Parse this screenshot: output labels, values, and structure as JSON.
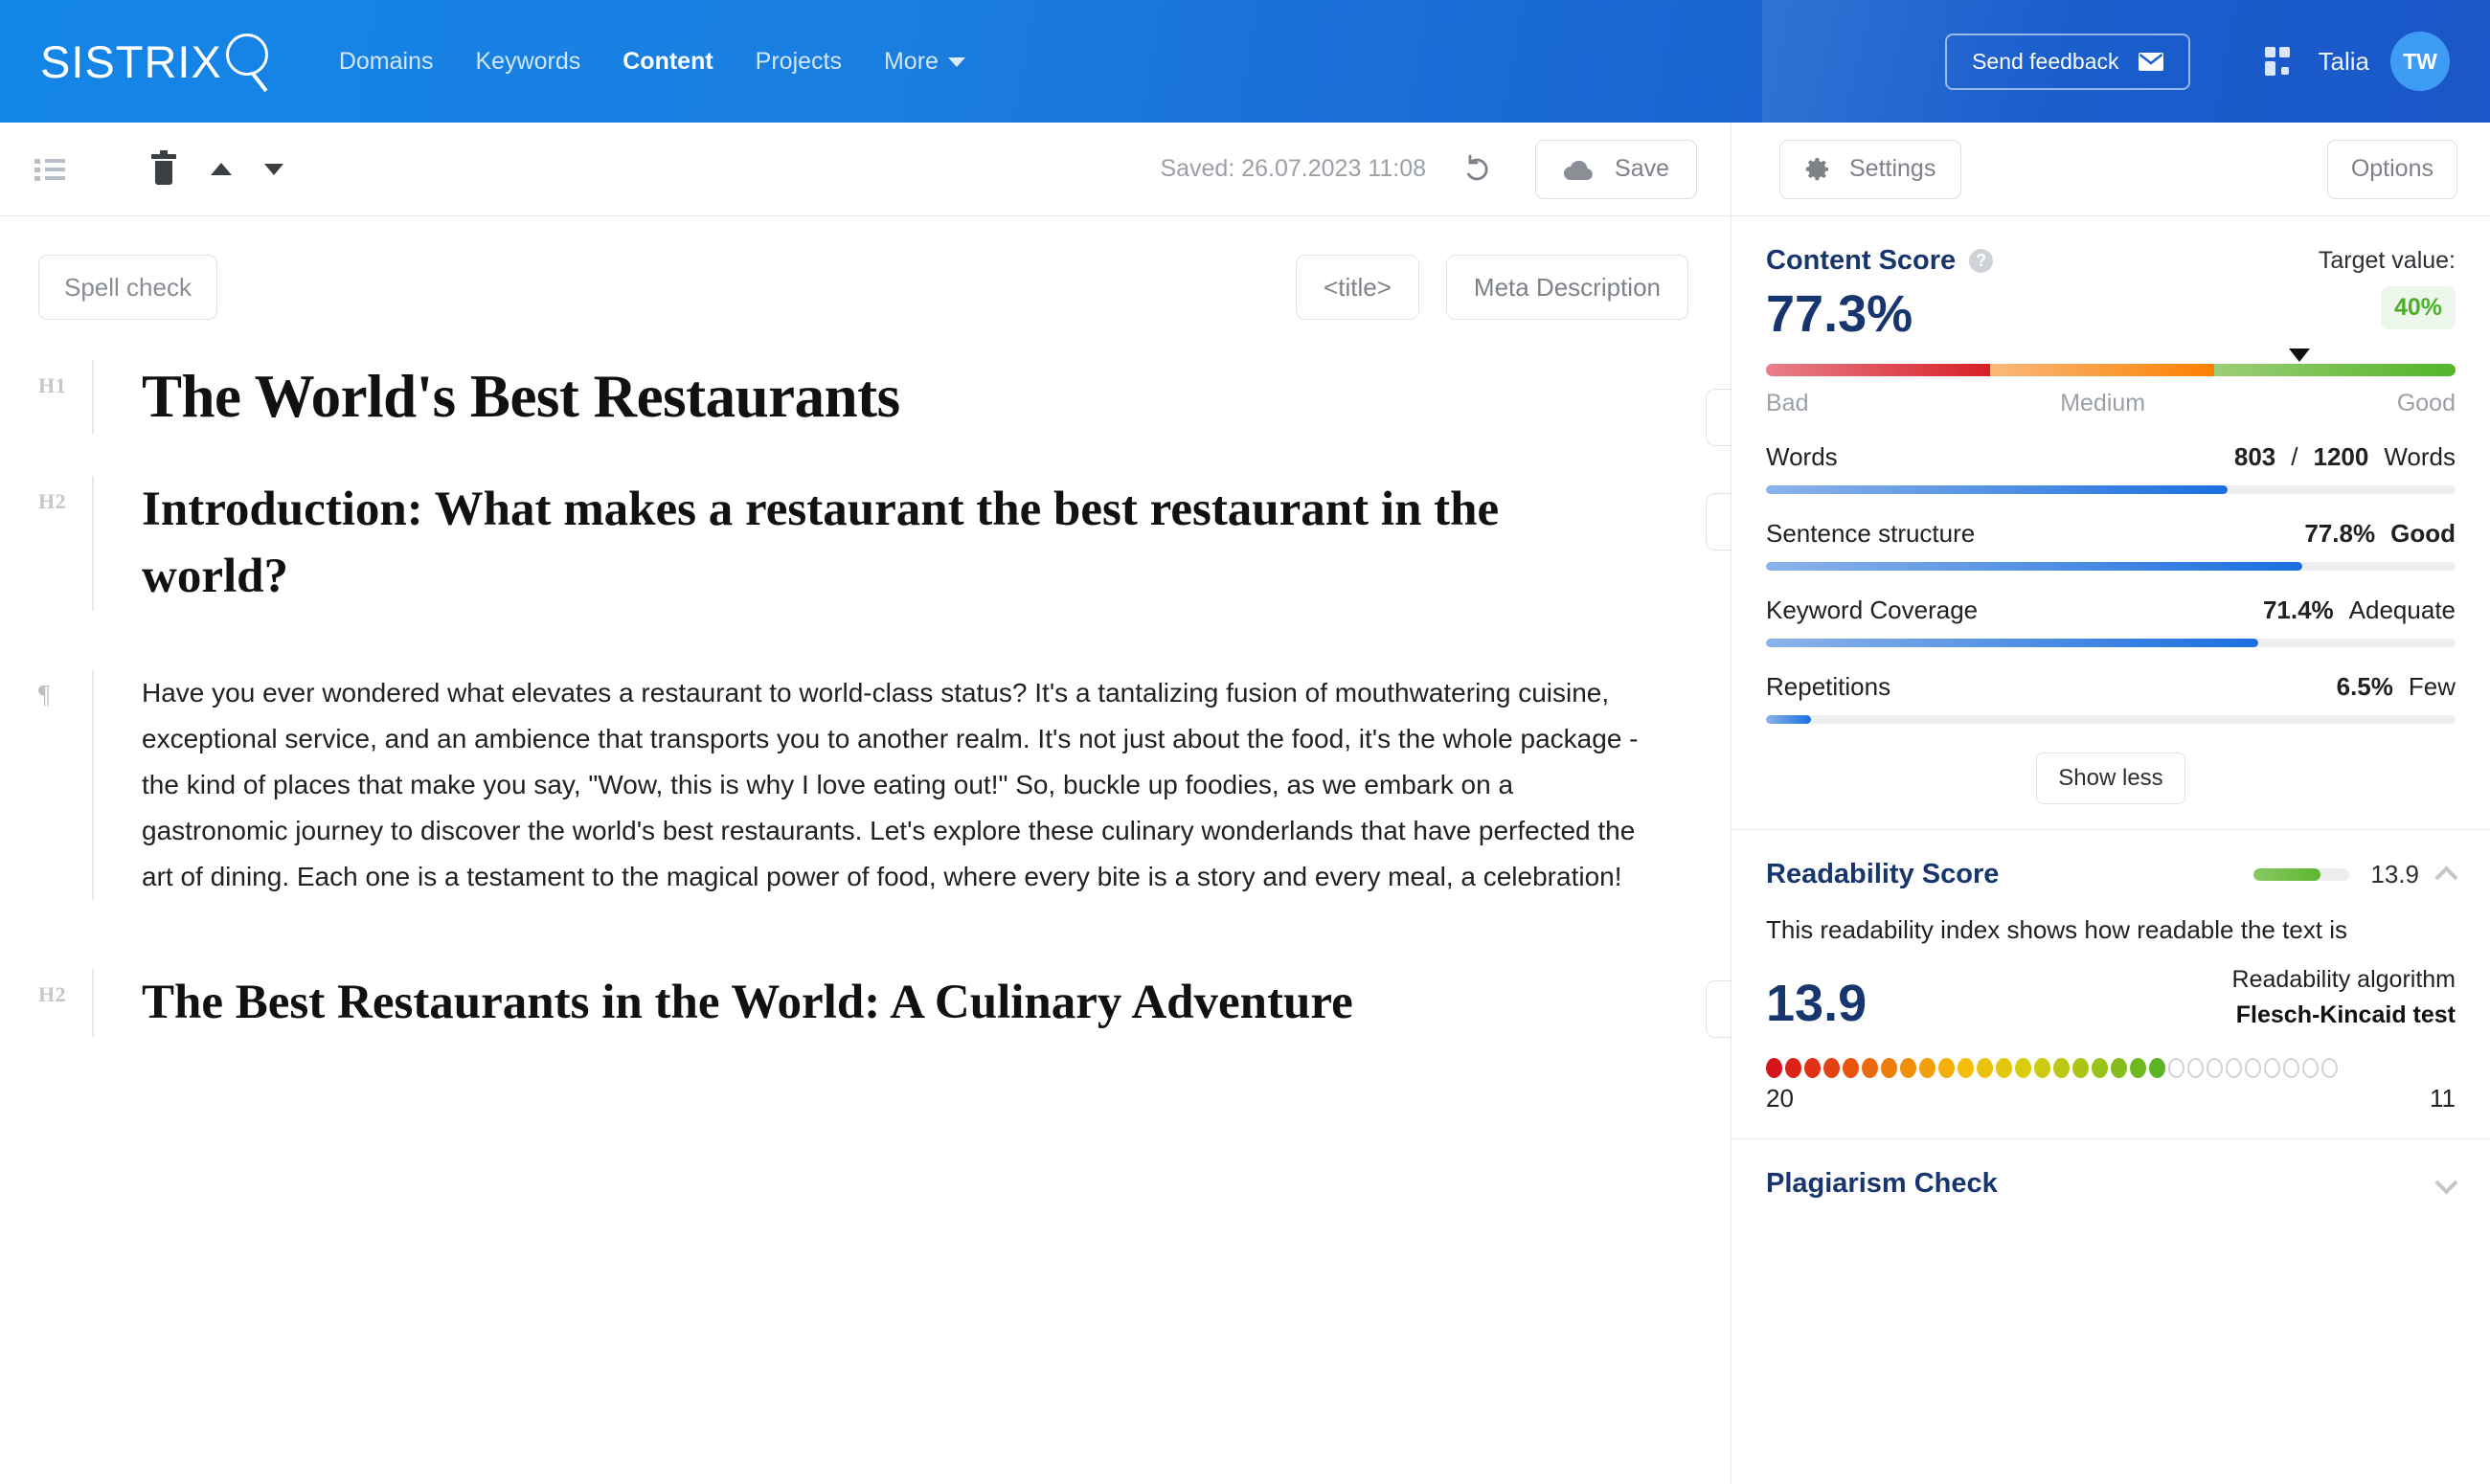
{
  "nav": {
    "brand": "SISTRIX",
    "links": [
      {
        "label": "Domains",
        "active": false
      },
      {
        "label": "Keywords",
        "active": false
      },
      {
        "label": "Content",
        "active": true
      },
      {
        "label": "Projects",
        "active": false
      },
      {
        "label": "More",
        "active": false
      }
    ],
    "feedback_label": "Send feedback",
    "username": "Talia",
    "avatar_initials": "TW",
    "brand_color": "#1a6fe0"
  },
  "toolbar": {
    "saved_text": "Saved: 26.07.2023 11:08",
    "save_label": "Save",
    "settings_label": "Settings",
    "options_label": "Options"
  },
  "editor": {
    "spell_check_label": "Spell check",
    "title_tag_label": "<title>",
    "meta_description_label": "Meta Description",
    "blocks": [
      {
        "tag": "H1",
        "type": "h1",
        "text": "The World's Best Restaurants"
      },
      {
        "tag": "H2",
        "type": "h2",
        "text": "Introduction: What makes a restaurant the best restaurant in the world?"
      },
      {
        "tag": "¶",
        "type": "p",
        "text": "Have you ever wondered what elevates a restaurant to world-class status? It's a tantalizing fusion of mouthwatering cuisine, exceptional service, and an ambience that transports you to another realm. It's not just about the food, it's the whole package - the kind of places that make you say, \"Wow, this is why I love eating out!\" So, buckle up foodies, as we embark on a gastronomic journey to discover the world's best restaurants. Let's explore these culinary wonderlands that have perfected the art of dining. Each one is a testament to the magical power of food, where every bite is a story and every meal, a celebration!"
      },
      {
        "tag": "H2",
        "type": "h2",
        "text": "The Best Restaurants in the World: A Culinary Adventure"
      }
    ]
  },
  "panel": {
    "content_score": {
      "title": "Content Score",
      "target_label": "Target value:",
      "score": "77.3%",
      "score_pct": 77.3,
      "target_value": "40%",
      "gauge_labels": {
        "bad": "Bad",
        "medium": "Medium",
        "good": "Good"
      },
      "metrics": [
        {
          "name": "Words",
          "value": "803",
          "separator": "/",
          "target": "1200",
          "unit": "Words",
          "fill_pct": 66.9
        },
        {
          "name": "Sentence structure",
          "value": "77.8%",
          "rating": "Good",
          "fill_pct": 77.8
        },
        {
          "name": "Keyword Coverage",
          "value": "71.4%",
          "rating": "Adequate",
          "fill_pct": 71.4
        },
        {
          "name": "Repetitions",
          "value": "6.5%",
          "rating": "Few",
          "fill_pct": 6.5
        }
      ],
      "show_less_label": "Show less"
    },
    "readability": {
      "title": "Readability Score",
      "mini_value": "13.9",
      "mini_fill_pct": 70,
      "description": "This readability index shows how readable the text is",
      "big_value": "13.9",
      "algorithm_label": "Readability algorithm",
      "algorithm_name": "Flesch-Kincaid test",
      "scale_left": "20",
      "scale_right": "11",
      "dots_total": 30,
      "dots_filled": 21
    },
    "plagiarism": {
      "title": "Plagiarism Check"
    }
  }
}
